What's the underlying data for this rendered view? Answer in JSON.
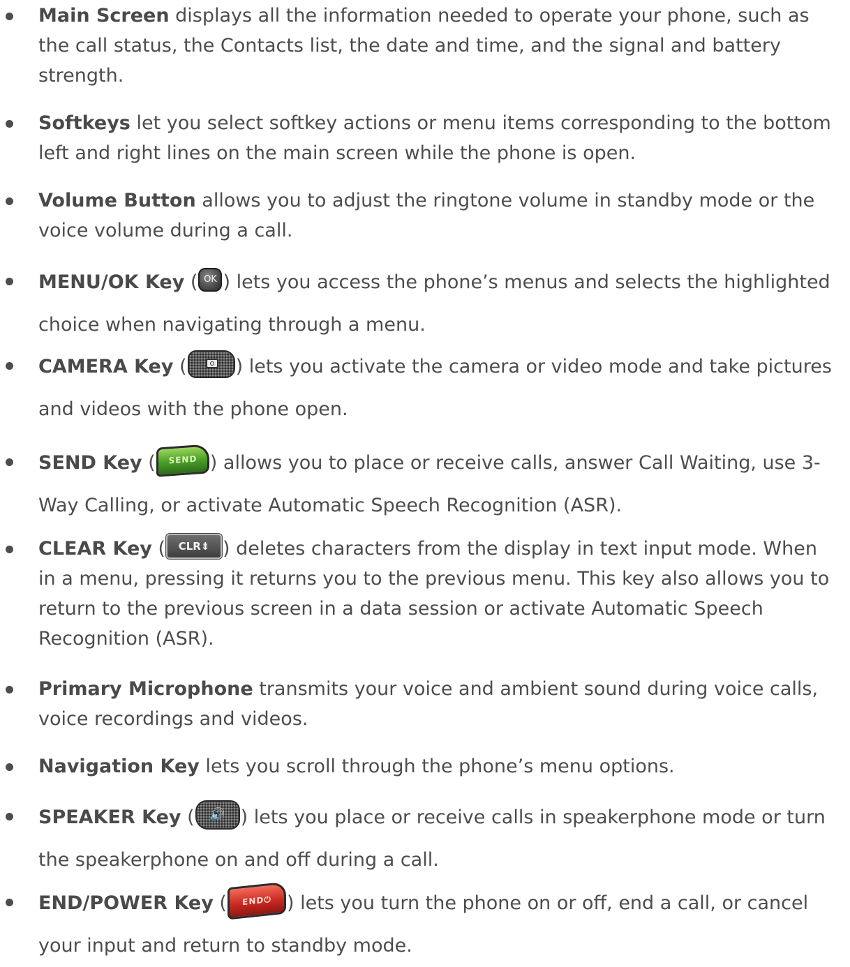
{
  "items": [
    {
      "term": "Main Screen",
      "text": " displays all the information needed to operate your phone, such as the call status, the Contacts list, the date and time, and the signal and battery strength."
    },
    {
      "term": "Softkeys",
      "text": " let you select softkey actions or menu items corresponding to the bottom left and right lines on the main screen while the phone is open."
    },
    {
      "term": "Volume Button",
      "text": " allows you to adjust the ringtone volume in standby mode or the voice volume during a call."
    },
    {
      "term": "MENU/OK Key",
      "open": " (",
      "icon_label": "OK",
      "icon_name": "ok-key-icon",
      "text": ") lets you access the phone’s menus and selects the highlighted choice when navigating through a menu."
    },
    {
      "term": "CAMERA Key",
      "open": " (",
      "icon_name": "camera-key-icon",
      "text": ") lets you activate the camera or video mode and take pictures and videos with the phone open."
    },
    {
      "term": "SEND Key",
      "open": " (",
      "icon_label": "SEND",
      "icon_name": "send-key-icon",
      "text": ") allows you to place or receive calls, answer Call Waiting, use 3-Way Calling, or activate Automatic Speech Recognition (ASR)."
    },
    {
      "term": "CLEAR Key",
      "open": " (",
      "icon_label": "CLR⇟",
      "icon_name": "clear-key-icon",
      "text": ") deletes characters from the display in text input mode. When in a menu, pressing it returns you to the previous menu. This key also allows you to return to the previous screen in a data session or activate Automatic Speech Recognition (ASR)."
    },
    {
      "term": "Primary Microphone",
      "text": " transmits your voice and ambient sound during voice calls, voice recordings and videos."
    },
    {
      "term": "Navigation Key",
      "text": " lets you scroll through the phone’s menu options."
    },
    {
      "term": "SPEAKER Key",
      "open": " (",
      "icon_label": "🔊",
      "icon_name": "speaker-key-icon",
      "text": ") lets you place or receive calls in speakerphone mode or turn the speakerphone on and off during a call."
    },
    {
      "term": "END/POWER Key",
      "open": " (",
      "icon_label": "END⏻",
      "icon_name": "end-power-key-icon",
      "text": ") lets you turn the phone on or off, end a call, or cancel your input and return to standby mode."
    }
  ]
}
